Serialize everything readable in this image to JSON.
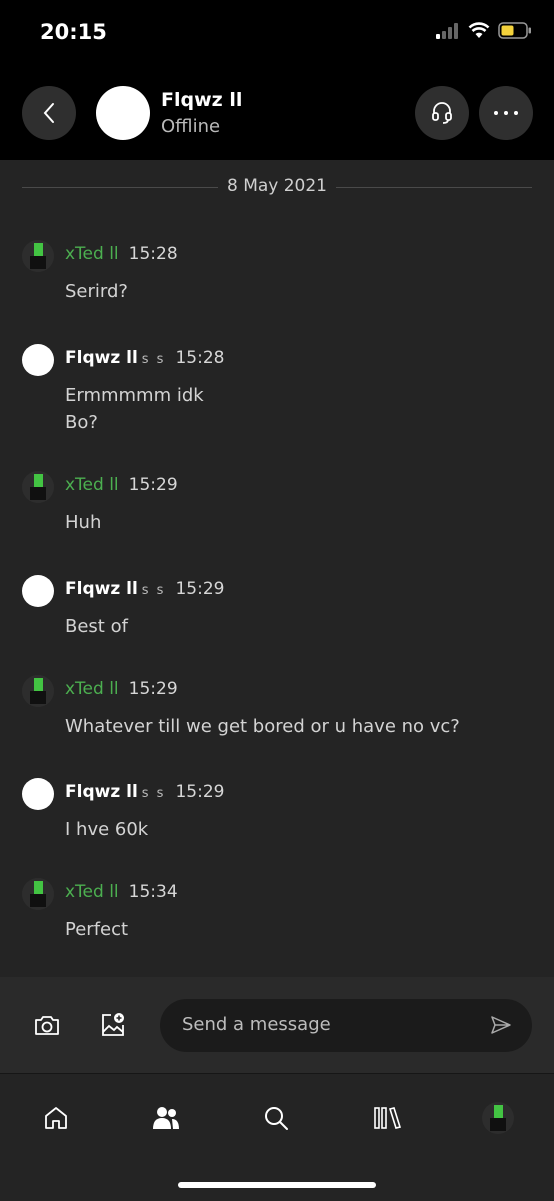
{
  "status_bar": {
    "time": "20:15"
  },
  "header": {
    "contact_name": "Flqwz ll",
    "contact_status": "Offline"
  },
  "date_divider": "8 May 2021",
  "messages": [
    {
      "sender": "xTed ll",
      "time": "15:28",
      "lines": [
        "Serird?"
      ]
    },
    {
      "sender": "Flqwz ll",
      "suffix": "s s",
      "time": "15:28",
      "lines": [
        "Ermmmmm idk",
        "Bo?"
      ]
    },
    {
      "sender": "xTed ll",
      "time": "15:29",
      "lines": [
        "Huh"
      ]
    },
    {
      "sender": "Flqwz ll",
      "suffix": "s s",
      "time": "15:29",
      "lines": [
        "Best of"
      ]
    },
    {
      "sender": "xTed ll",
      "time": "15:29",
      "lines": [
        "Whatever till we get bored or u have no vc?"
      ]
    },
    {
      "sender": "Flqwz ll",
      "suffix": "s s",
      "time": "15:29",
      "lines": [
        "I hve 60k"
      ]
    },
    {
      "sender": "xTed ll",
      "time": "15:34",
      "lines": [
        "Perfect"
      ]
    }
  ],
  "composer": {
    "placeholder": "Send a message"
  },
  "colors": {
    "xted_name": "#4caf50",
    "background": "#242424",
    "header": "#000000"
  },
  "nav": [
    "home-icon",
    "friends-icon",
    "search-icon",
    "library-icon",
    "profile-avatar"
  ]
}
